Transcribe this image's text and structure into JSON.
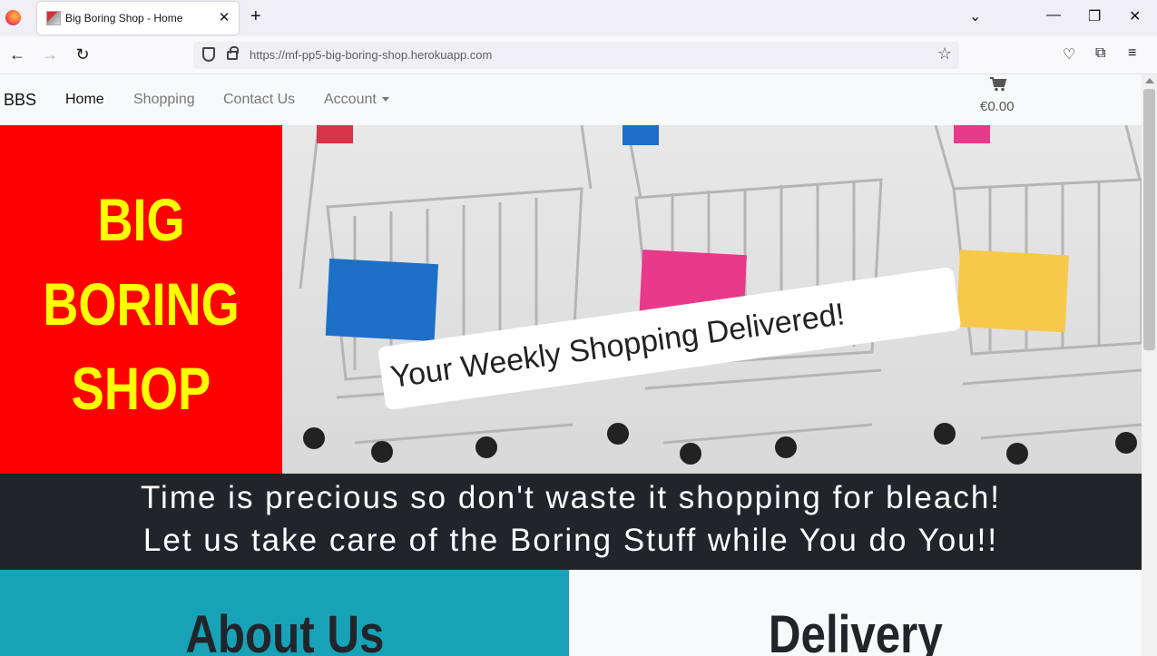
{
  "browser": {
    "tab_title": "Big Boring Shop - Home",
    "tab_close": "✕",
    "new_tab": "+",
    "url": "https://mf-pp5-big-boring-shop.herokuapp.com",
    "controls": {
      "list": "⌄",
      "minimize": "—",
      "restore": "❐",
      "close": "✕"
    },
    "nav": {
      "back": "←",
      "forward": "→",
      "reload": "↻"
    },
    "bookmark_star": "☆",
    "tools": {
      "pocket": "♡",
      "extensions": "⧉",
      "menu": "≡"
    }
  },
  "site": {
    "brand": "BBS",
    "links": [
      "Home",
      "Shopping",
      "Contact Us",
      "Account"
    ],
    "cart_total": "€0.00"
  },
  "hero": {
    "title_lines": [
      "BIG",
      "BORING",
      "SHOP"
    ],
    "tagline": "Your Weekly Shopping Delivered!"
  },
  "banner": {
    "line1": "Time is precious so don't waste it shopping for bleach!",
    "line2": "Let us take care of the Boring Stuff while You do You!!"
  },
  "sections": {
    "about": "About Us",
    "delivery": "Delivery"
  },
  "colors": {
    "hero_red": "#ff0000",
    "hero_text": "#ffff00",
    "banner_bg": "#212529",
    "about_bg": "#17a2b8"
  }
}
